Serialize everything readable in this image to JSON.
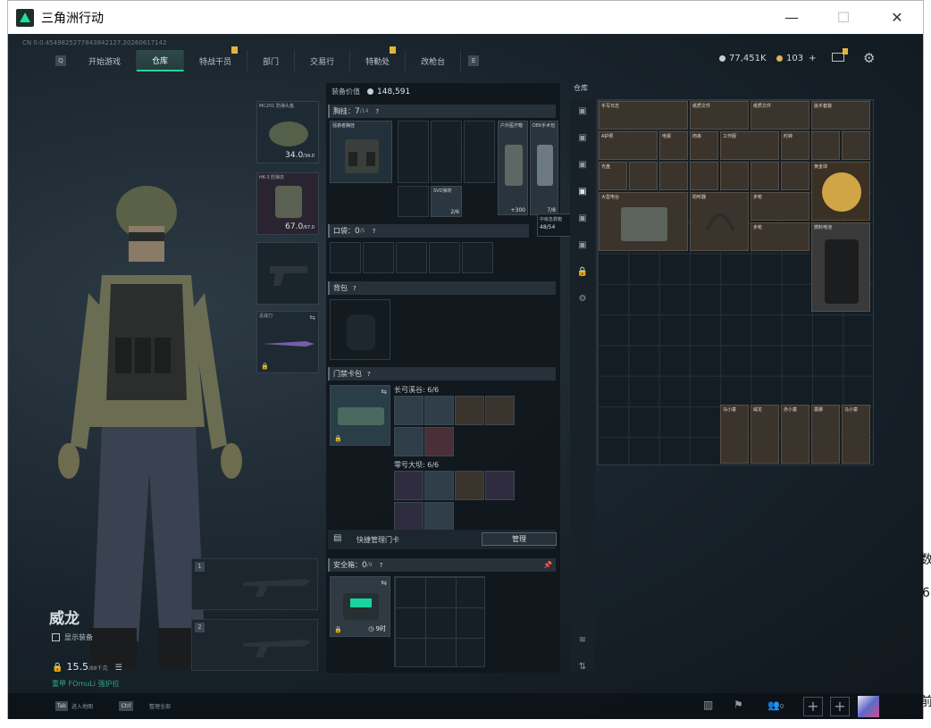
{
  "window": {
    "title": "三角洲行动",
    "min": "—",
    "max": "☐",
    "close": "✕"
  },
  "header": {
    "build_id": "CN 0.0.4549825277843842127.20260617142",
    "nav_prev_key": "Q",
    "nav_next_key": "E",
    "tabs": [
      "开始游戏",
      "仓库",
      "特战干员",
      "部门",
      "交易行",
      "特勤处",
      "改枪台"
    ],
    "active_tab": "仓库",
    "currency_main": "77,451K",
    "currency_coin": "103",
    "currency_add": "+"
  },
  "character": {
    "name": "威龙",
    "show_gear_label": "显示装备",
    "weight_value": "15.5",
    "weight_max": "/88千克",
    "subtitle": "重甲 FOmuLi 强护拉",
    "helmet": {
      "label": "MC201 防弹头盔",
      "value": "34.0",
      "max": "/34.0"
    },
    "armor": {
      "label": "HK-3 防弹衣",
      "value": "67.0",
      "max": "/67.0"
    },
    "melee_label": "近战刀",
    "weapon1_num": "1",
    "weapon2_num": "2"
  },
  "equipment": {
    "value_label": "装备价值",
    "value": "148,591",
    "chest_label": "胸挂：",
    "chest_count": "7",
    "chest_max": "/14",
    "chest_item_label": "强袭者胸挂",
    "item_outdoor": "户外医疗箱",
    "item_dek": "DEK手术包",
    "item_outdoor_val": "+300",
    "item_dek_val": "7/8",
    "item_svd": "SVD弹药",
    "item_svd_val": "2/6",
    "tooltip_title": "中级急救箱",
    "tooltip_val": "48/54",
    "pocket_label": "口袋：",
    "pocket_count": "0",
    "pocket_max": "/5",
    "backpack_label": "背包",
    "keycard_label": "门禁卡包",
    "keycard_group1": "长弓溪谷: 6/6",
    "keycard_group2": "零号大坝: 6/6",
    "quick_manage": "快捷管理门卡",
    "manage_btn": "管理",
    "safebox_label": "安全箱：",
    "safebox_count": "0",
    "safebox_max": "/9",
    "safebox_time": "9时"
  },
  "storage": {
    "title": "仓库",
    "items": [
      {
        "label": "手写日志"
      },
      {
        "label": "纸质文件"
      },
      {
        "label": "纸质文件"
      },
      {
        "label": "扳手套装"
      },
      {
        "label": "A护照"
      },
      {
        "label": "电报"
      },
      {
        "label": "肉串"
      },
      {
        "label": "工作服"
      },
      {
        "label": "时钟"
      },
      {
        "label": "光盘"
      },
      {
        "label": "大型电台"
      },
      {
        "label": "助听器"
      },
      {
        "label": "步枪"
      },
      {
        "label": "步枪"
      },
      {
        "label": "黄金球"
      },
      {
        "label": "燃料电池"
      },
      {
        "label": "马小童"
      },
      {
        "label": "威龙"
      },
      {
        "label": "赤小童"
      },
      {
        "label": "露娜"
      },
      {
        "label": "马小童"
      }
    ]
  },
  "bottom": {
    "tab_key": "Tab",
    "tab_text": "进入地图",
    "ctrl_key": "Ctrl",
    "ctrl_text": "整理全部",
    "party_count": "0"
  },
  "outside_text": {
    "c1": "数",
    "c2": "6",
    "c3": "前"
  },
  "colors": {
    "accent": "#27d69e",
    "badge": "#e3b63a",
    "gold_item": "#3b342c"
  }
}
